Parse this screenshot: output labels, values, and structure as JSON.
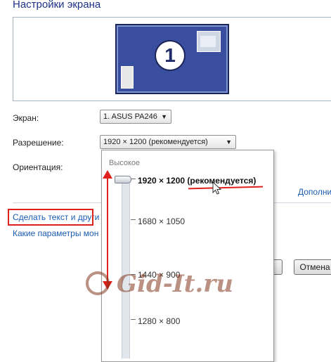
{
  "window": {
    "title": "Настройки экрана"
  },
  "monitor_preview": {
    "number": "1"
  },
  "fields": {
    "screen_label": "Экран:",
    "screen_value": "1. ASUS PA246",
    "resolution_label": "Разрешение:",
    "resolution_value": "1920 × 1200 (рекомендуется)",
    "orientation_label": "Ориентация:"
  },
  "links": {
    "advanced_partial": "Дополни",
    "make_text": "Сделать текст и други",
    "which_params": "Какие параметры мон"
  },
  "buttons": {
    "cancel": "Отмена"
  },
  "resolution_dropdown": {
    "top_label": "Высокое",
    "options": [
      {
        "label": "1920 × 1200 (рекомендуется)",
        "selected": true
      },
      {
        "label": "1680 × 1050",
        "selected": false
      },
      {
        "label": "1440 × 900",
        "selected": false
      },
      {
        "label": "1280 × 800",
        "selected": false
      }
    ],
    "slider_level": 1.0
  },
  "watermark": {
    "text": "Gid-It.ru"
  },
  "colors": {
    "annotation_red": "#e0201c",
    "title_blue": "#1e3287",
    "link_blue": "#1a5cb0"
  }
}
